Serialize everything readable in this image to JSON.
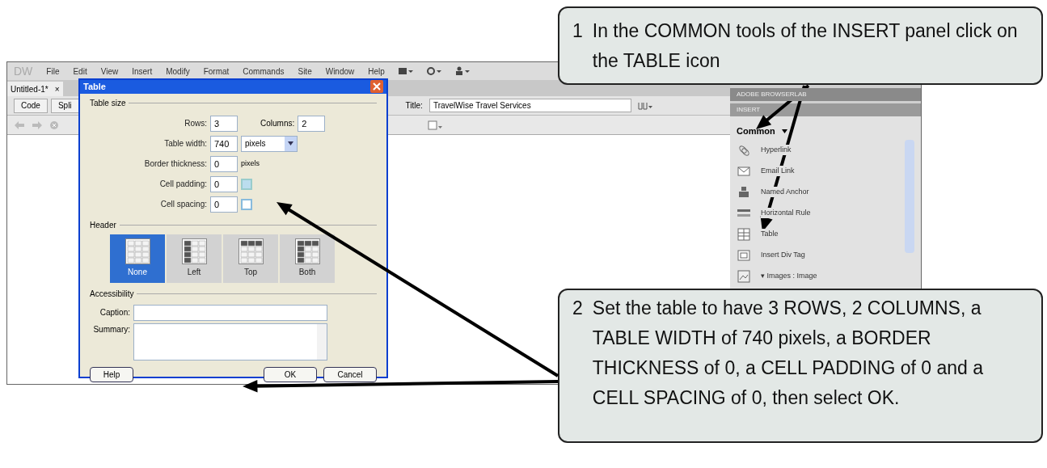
{
  "app": {
    "logo": "DW",
    "menu": [
      "File",
      "Edit",
      "View",
      "Insert",
      "Modify",
      "Format",
      "Commands",
      "Site",
      "Window",
      "Help"
    ],
    "doc_tab": {
      "label": "Untitled-1*",
      "close": "×"
    },
    "view_buttons": [
      {
        "label": "Code",
        "selected": false
      },
      {
        "label": "Spli",
        "selected": false
      }
    ],
    "title_label": "Title:",
    "title_value": "TravelWise Travel Services",
    "panels": {
      "browserlab": "ADOBE BROWSERLAB",
      "insert": "INSERT",
      "category": "Common",
      "items": [
        {
          "label": "Hyperlink",
          "kind": "hyperlink"
        },
        {
          "label": "Email Link",
          "kind": "email"
        },
        {
          "label": "Named Anchor",
          "kind": "anchor"
        },
        {
          "label": "Horizontal Rule",
          "kind": "rule"
        },
        {
          "label": "Table",
          "kind": "table"
        },
        {
          "label": "Insert Div Tag",
          "kind": "div"
        },
        {
          "label": "▾ Images : Image",
          "kind": "image"
        }
      ]
    }
  },
  "dialog": {
    "title": "Table",
    "size_section": "Table size",
    "rows": {
      "label": "Rows:",
      "value": "3"
    },
    "columns": {
      "label": "Columns:",
      "value": "2"
    },
    "width": {
      "label": "Table width:",
      "value": "740",
      "unit": "pixels"
    },
    "border": {
      "label": "Border thickness:",
      "value": "0",
      "unit": "pixels"
    },
    "padding": {
      "label": "Cell padding:",
      "value": "0"
    },
    "spacing": {
      "label": "Cell spacing:",
      "value": "0"
    },
    "header_section": "Header",
    "header_options": [
      {
        "label": "None",
        "kind": "none",
        "selected": true
      },
      {
        "label": "Left",
        "kind": "left",
        "selected": false
      },
      {
        "label": "Top",
        "kind": "top",
        "selected": false
      },
      {
        "label": "Both",
        "kind": "both",
        "selected": false
      }
    ],
    "accessibility_section": "Accessibility",
    "caption_label": "Caption:",
    "summary_label": "Summary:",
    "buttons": {
      "help": "Help",
      "ok": "OK",
      "cancel": "Cancel"
    }
  },
  "callouts": [
    {
      "number": "1",
      "text": "In the COMMON tools of the INSERT panel click on the TABLE icon"
    },
    {
      "number": "2",
      "text": "Set the table to have 3 ROWS, 2 COLUMNS, a TABLE WIDTH of 740 pixels, a BORDER THICKNESS of 0, a CELL PADDING of 0 and a CELL SPACING of 0, then select OK."
    }
  ]
}
